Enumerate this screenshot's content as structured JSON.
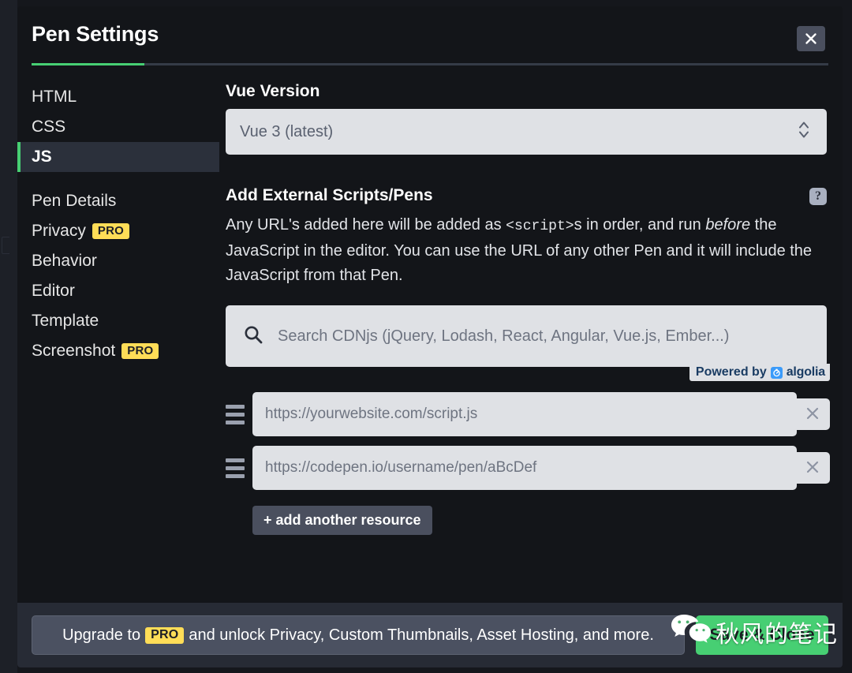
{
  "header": {
    "title": "Pen Settings",
    "close_icon": "close-icon"
  },
  "sidebar": {
    "editor_tabs": [
      {
        "label": "HTML",
        "active": false
      },
      {
        "label": "CSS",
        "active": false
      },
      {
        "label": "JS",
        "active": true
      }
    ],
    "settings_items": [
      {
        "label": "Pen Details",
        "badge": ""
      },
      {
        "label": "Privacy",
        "badge": "PRO"
      },
      {
        "label": "Behavior",
        "badge": ""
      },
      {
        "label": "Editor",
        "badge": ""
      },
      {
        "label": "Template",
        "badge": ""
      },
      {
        "label": "Screenshot",
        "badge": "PRO"
      }
    ]
  },
  "main": {
    "vue_version": {
      "label": "Vue Version",
      "selected": "Vue 3 (latest)",
      "caret_icon": "chevron-up-down-icon"
    },
    "scripts": {
      "label": "Add External Scripts/Pens",
      "help_icon": "question-mark-icon",
      "help_label": "?",
      "description_part1": "Any URL's added here will be added as ",
      "description_code": "<script>",
      "description_part2": "s in order, and run ",
      "description_em": "before",
      "description_part3": " the JavaScript in the editor. You can use the URL of any other Pen and it will include the JavaScript from that Pen.",
      "search_placeholder": "Search CDNjs (jQuery, Lodash, React, Angular, Vue.js, Ember...)",
      "search_icon": "search-icon",
      "algolia": {
        "powered_by": "Powered by",
        "name": "algolia",
        "mark_icon": "algolia-logo-icon"
      },
      "resources": [
        {
          "drag_icon": "drag-handle-icon",
          "placeholder": "https://yourwebsite.com/script.js",
          "remove_icon": "close-icon"
        },
        {
          "drag_icon": "drag-handle-icon",
          "placeholder": "https://codepen.io/username/pen/aBcDef",
          "remove_icon": "close-icon"
        }
      ],
      "add_resource_label": "+ add another resource"
    }
  },
  "footer": {
    "upgrade_prefix": "Upgrade to",
    "upgrade_badge": "PRO",
    "upgrade_suffix": "and unlock Privacy, Custom Thumbnails, Asset Hosting, and more.",
    "save_label": "Save & Close"
  },
  "watermark": {
    "logo_icon": "wechat-logo-icon",
    "text": "秋风的笔记"
  },
  "colors": {
    "accent_green": "#47cf73",
    "pro_yellow": "#ffdd57",
    "modal_bg": "#131519",
    "footer_bg": "#272b35",
    "input_bg": "#dfe1e5"
  }
}
